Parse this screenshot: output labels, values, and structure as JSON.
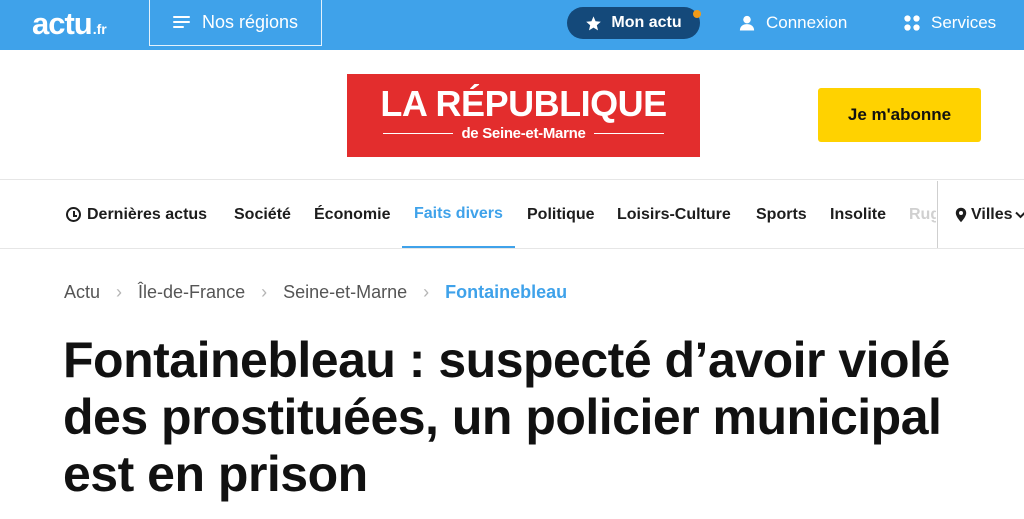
{
  "topbar": {
    "logo_main": "actu",
    "logo_tld": ".fr",
    "regions_label": "Nos régions",
    "mon_actu_label": "Mon actu",
    "connexion_label": "Connexion",
    "services_label": "Services"
  },
  "masthead": {
    "brand_name": "LA RÉPUBLIQUE",
    "brand_sub": "de Seine-et-Marne",
    "subscribe_label": "Je m'abonne"
  },
  "nav": {
    "items": [
      {
        "label": "Dernières actus"
      },
      {
        "label": "Société"
      },
      {
        "label": "Économie"
      },
      {
        "label": "Faits divers"
      },
      {
        "label": "Politique"
      },
      {
        "label": "Loisirs-Culture"
      },
      {
        "label": "Sports"
      },
      {
        "label": "Insolite"
      },
      {
        "label": "Rugby"
      }
    ],
    "villes_label": "Villes"
  },
  "breadcrumb": [
    "Actu",
    "Île-de-France",
    "Seine-et-Marne",
    "Fontainebleau"
  ],
  "article": {
    "headline": "Fontainebleau : suspecté d’avoir violé des prostituées, un policier municipal est en prison"
  },
  "colors": {
    "topbar": "#3fa2ea",
    "mon_actu_bg": "#14497a",
    "notification_dot": "#f29b17",
    "brand_red": "#e32d2d",
    "subscribe_yellow": "#ffd200",
    "accent_blue": "#3fa2ea"
  },
  "icons": {
    "regions": "menu-icon",
    "mon_actu": "star-icon",
    "connexion": "user-icon",
    "services": "grid-icon",
    "dernieres_actus": "clock-icon",
    "villes": "map-pin-icon",
    "villes_dropdown": "chevron-down-icon",
    "breadcrumb_separator": "chevron-right-icon"
  }
}
